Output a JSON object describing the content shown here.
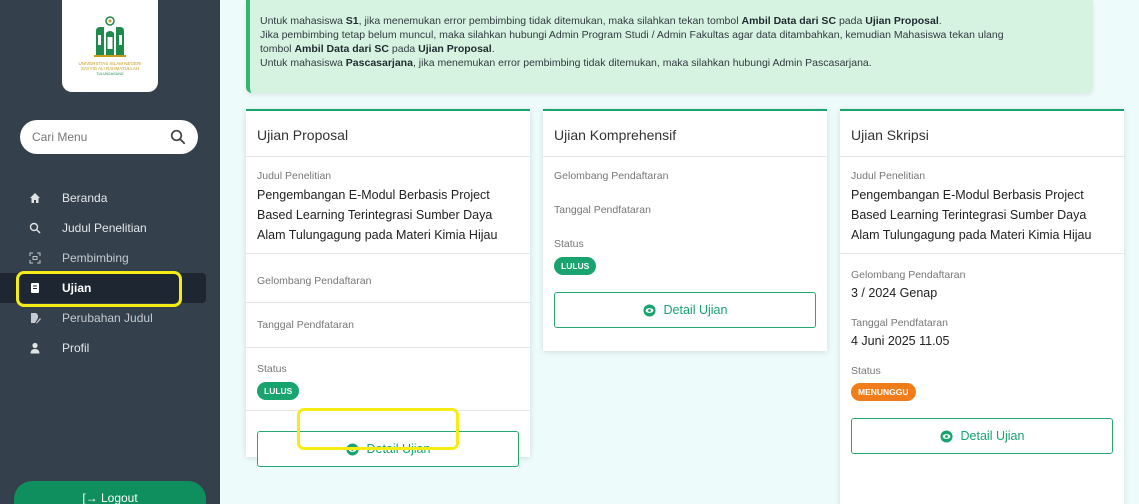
{
  "app": {
    "logo_text": "UNIVERSITAS ISLAM NEGERI SAYYID ALI RAHMATULLAH",
    "logo_subtext": "TULUNGAGUNG"
  },
  "sidebar": {
    "search": {
      "placeholder": "Cari Menu"
    },
    "items": [
      {
        "label": "Beranda",
        "icon": "home-icon"
      },
      {
        "label": "Judul Penelitian",
        "icon": "search-icon"
      },
      {
        "label": "Pembimbing",
        "icon": "qr-icon"
      },
      {
        "label": "Ujian",
        "icon": "book-icon",
        "active": true
      },
      {
        "label": "Perubahan Judul",
        "icon": "file-edit-icon"
      },
      {
        "label": "Profil",
        "icon": "user-icon"
      }
    ],
    "logout_label": "[→ Logout"
  },
  "alert": {
    "line1_pre": "Untuk mahasiswa ",
    "line1_b1": "S1",
    "line1_mid": ", jika menemukan error pembimbing tidak ditemukan, maka silahkan tekan tombol ",
    "line1_b2": "Ambil Data dari SC",
    "line1_mid2": " pada ",
    "line1_b3": "Ujian Proposal",
    "line1_end": ".",
    "line2": "Jika pembimbing tetap belum muncul, maka silahkan hubungi Admin Program Studi / Admin Fakultas agar data ditambahkan, kemudian Mahasiswa tekan ulang",
    "line3_pre": "tombol ",
    "line3_b1": "Ambil Data dari SC",
    "line3_mid": " pada ",
    "line3_b2": "Ujian Proposal",
    "line3_end": ".",
    "line4_pre": "Untuk mahasiswa ",
    "line4_b1": "Pascasarjana",
    "line4_end": ", jika menemukan error pembimbing tidak ditemukan, maka silahkan hubungi Admin Pascasarjana."
  },
  "cards": {
    "proposal": {
      "title": "Ujian Proposal",
      "judul_label": "Judul Penelitian",
      "judul_value": "Pengembangan E-Modul Berbasis Project Based Learning Terintegrasi Sumber Daya Alam Tulungagung pada Materi Kimia Hijau",
      "gelombang_label": "Gelombang Pendaftaran",
      "tanggal_label": "Tanggal Pendfataran",
      "status_label": "Status",
      "status_value": "LULUS",
      "button_label": "Detail Ujian"
    },
    "komprehensif": {
      "title": "Ujian Komprehensif",
      "gelombang_label": "Gelombang Pendaftaran",
      "tanggal_label": "Tanggal Pendfataran",
      "status_label": "Status",
      "status_value": "LULUS",
      "button_label": "Detail Ujian"
    },
    "skripsi": {
      "title": "Ujian Skripsi",
      "judul_label": "Judul Penelitian",
      "judul_value": "Pengembangan E-Modul Berbasis Project Based Learning Terintegrasi Sumber Daya Alam Tulungagung pada Materi Kimia Hijau",
      "gelombang_label": "Gelombang Pendaftaran",
      "gelombang_value": "3 / 2024 Genap",
      "tanggal_label": "Tanggal Pendfataran",
      "tanggal_value": "4 Juni 2025 11.05",
      "status_label": "Status",
      "status_value": "MENUNGGU",
      "button_label": "Detail Ujian"
    }
  },
  "colors": {
    "sidebar_bg": "#34404c",
    "accent_green": "#18a36f",
    "status_pending": "#f07c1a",
    "highlight": "#f5ec14"
  }
}
